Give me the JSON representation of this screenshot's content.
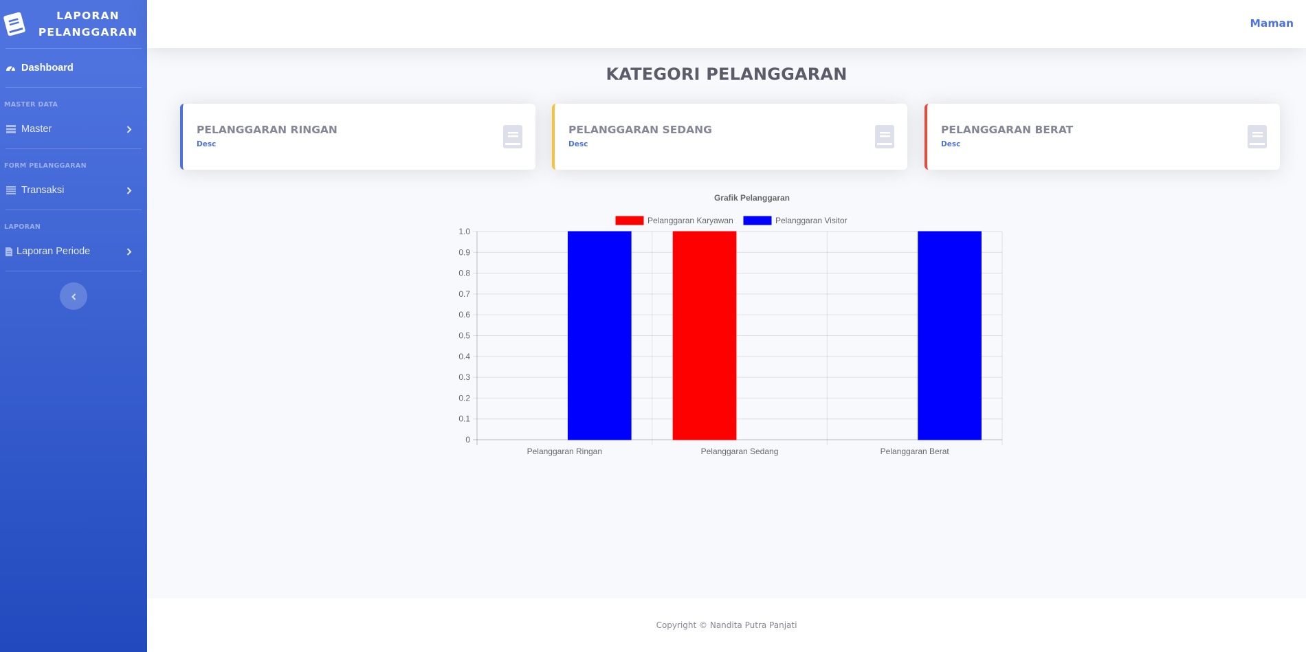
{
  "app": {
    "brand_line1": "LAPORAN",
    "brand_line2": "PELANGGARAN"
  },
  "sidebar": {
    "dashboard_label": "Dashboard",
    "sections": [
      {
        "heading": "MASTER DATA",
        "item": "Master"
      },
      {
        "heading": "FORM PELANGGARAN",
        "item": "Transaksi"
      },
      {
        "heading": "LAPORAN",
        "item": "Laporan Periode"
      }
    ]
  },
  "topbar": {
    "user_name": "Maman"
  },
  "main": {
    "title": "KATEGORI PELANGGARAN",
    "cards": [
      {
        "title": "PELANGGARAN RINGAN",
        "desc": "Desc",
        "accent": "#4e73df"
      },
      {
        "title": "PELANGGARAN SEDANG",
        "desc": "Desc",
        "accent": "#f6c23e"
      },
      {
        "title": "PELANGGARAN BERAT",
        "desc": "Desc",
        "accent": "#e74a3b"
      }
    ]
  },
  "chart_data": {
    "type": "bar",
    "title": "Grafik Pelanggaran",
    "categories": [
      "Pelanggaran Ringan",
      "Pelanggaran Sedang",
      "Pelanggaran Berat"
    ],
    "series": [
      {
        "name": "Pelanggaran Karyawan",
        "color": "#ff0000",
        "values": [
          0,
          1,
          0
        ]
      },
      {
        "name": "Pelanggaran Visitor",
        "color": "#0000ff",
        "values": [
          1,
          0,
          1
        ]
      }
    ],
    "ylim": [
      0,
      1
    ],
    "yticks": [
      "0",
      "0.1",
      "0.2",
      "0.3",
      "0.4",
      "0.5",
      "0.6",
      "0.7",
      "0.8",
      "0.9",
      "1.0"
    ],
    "legend": "top",
    "grid": true
  },
  "footer": {
    "copyright": "Copyright © Nandita Putra Panjati"
  },
  "colors": {
    "primary": "#4e73df",
    "warning": "#f6c23e",
    "danger": "#e74a3b",
    "text": "#5a5c69",
    "muted": "#858796"
  }
}
